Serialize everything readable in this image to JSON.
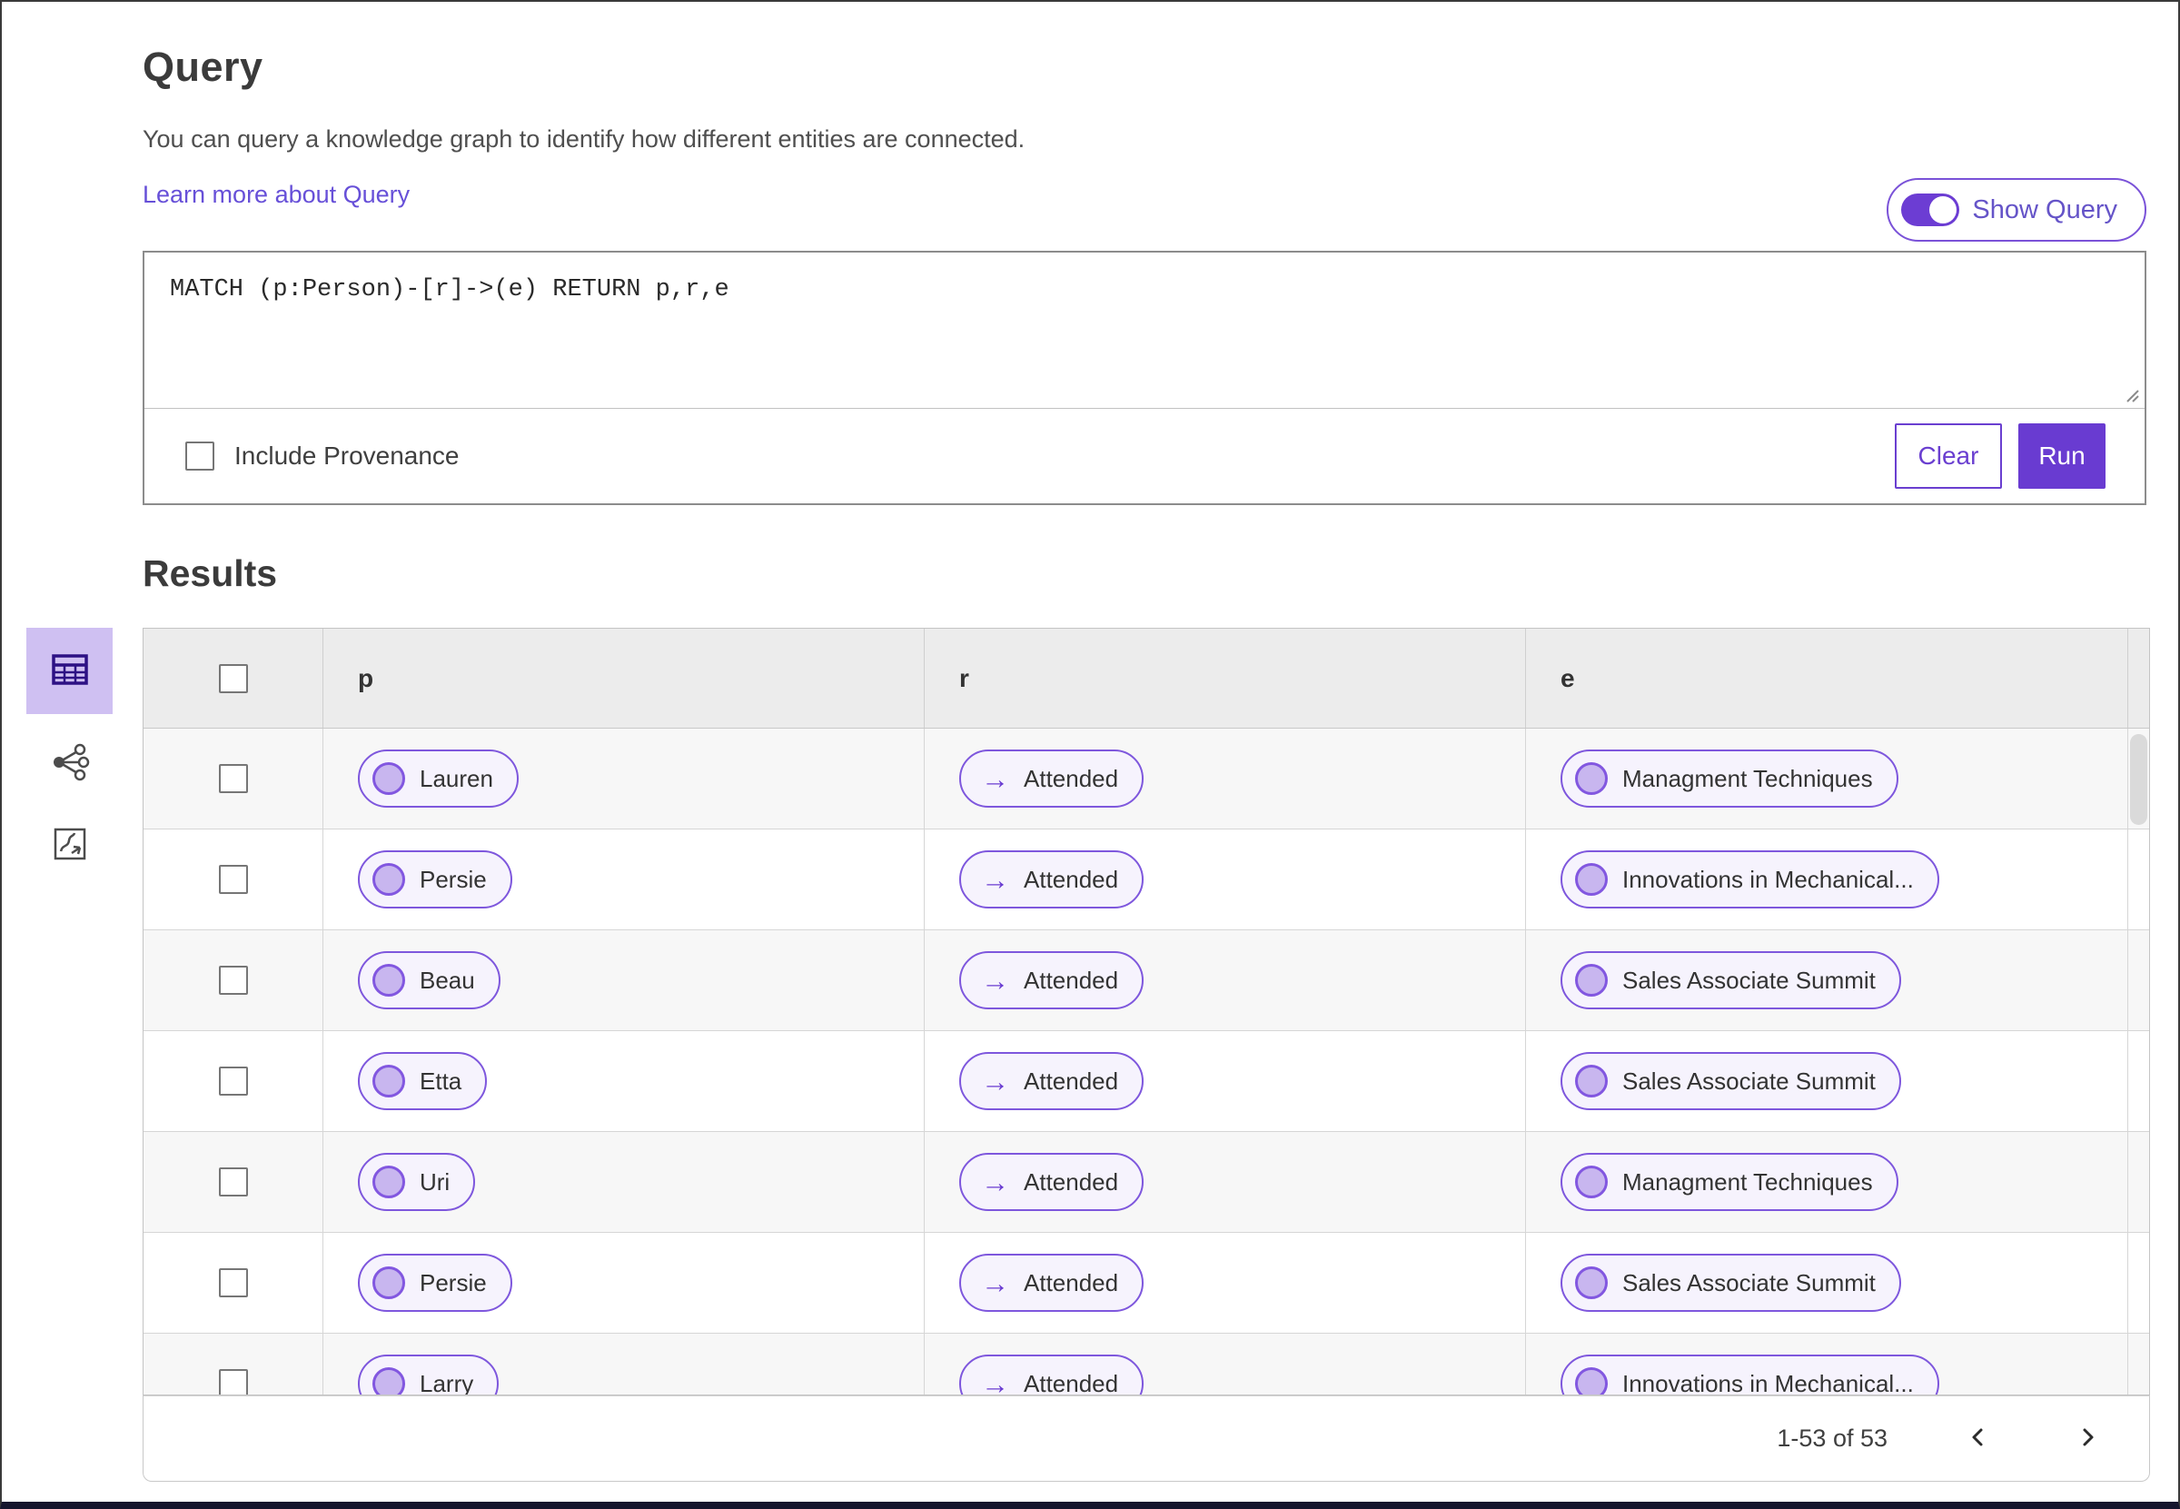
{
  "header": {
    "title": "Query",
    "description": "You can query a knowledge graph to identify how different entities are connected.",
    "learn_more_link": "Learn more about Query",
    "show_query_toggle": {
      "label": "Show Query",
      "state": "on"
    }
  },
  "query_editor": {
    "query_text": "MATCH (p:Person)-[r]->(e) RETURN p,r,e",
    "include_provenance": {
      "label": "Include Provenance",
      "checked": false
    },
    "clear_button": "Clear",
    "run_button": "Run"
  },
  "results": {
    "title": "Results",
    "view_rail": [
      {
        "name": "table-view",
        "icon": "table-grid-icon",
        "selected": true
      },
      {
        "name": "graph-view",
        "icon": "network-icon",
        "selected": false
      },
      {
        "name": "map-view",
        "icon": "route-map-icon",
        "selected": false
      }
    ],
    "table": {
      "columns": [
        "p",
        "r",
        "e"
      ],
      "rows": [
        {
          "p": "Lauren",
          "r": "Attended",
          "e": "Managment Techniques"
        },
        {
          "p": "Persie",
          "r": "Attended",
          "e": "Innovations in Mechanical..."
        },
        {
          "p": "Beau",
          "r": "Attended",
          "e": "Sales Associate Summit"
        },
        {
          "p": "Etta",
          "r": "Attended",
          "e": "Sales Associate Summit"
        },
        {
          "p": "Uri",
          "r": "Attended",
          "e": "Managment Techniques"
        },
        {
          "p": "Persie",
          "r": "Attended",
          "e": "Sales Associate Summit"
        },
        {
          "p": "Larry",
          "r": "Attended",
          "e": "Innovations in Mechanical..."
        }
      ]
    },
    "pagination": {
      "range_label": "1-53 of 53"
    }
  },
  "icons": {
    "edge_arrow": "→",
    "prev": "chevron-left-icon",
    "next": "chevron-right-icon"
  },
  "colors": {
    "accent": "#693bd1",
    "pill_border": "#7e57dd",
    "pill_bg": "#f6f3fd",
    "node_fill": "#c8b6ef",
    "selected_tile_bg": "#cfc0f2",
    "link": "#6750d8",
    "header_row_bg": "#ececec",
    "stripe_bg": "#f7f7f7"
  }
}
